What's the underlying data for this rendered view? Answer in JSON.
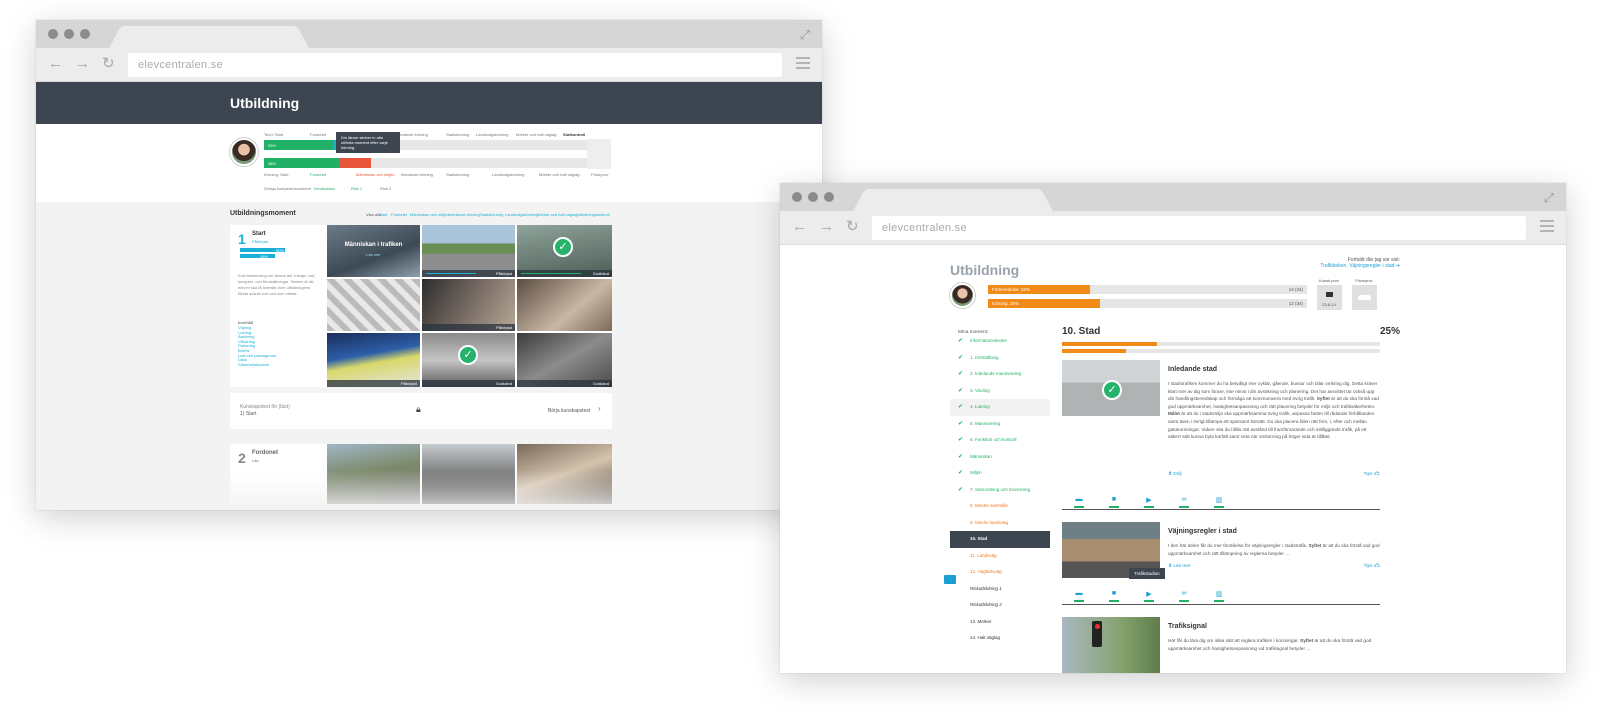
{
  "back_window": {
    "url": "elevcentralen.se",
    "hero_title": "Utbildning",
    "progress_headers": [
      "Start",
      "Fordonet",
      "Människan och miljön",
      "Inledande körning",
      "Stadskörning",
      "Landsvägskörning",
      "Mörker och halt väglag",
      "Slutkontroll"
    ],
    "teori_label": "Teori: Start",
    "korning_label": "Körning: Start",
    "bar1_pct": "33%",
    "bar2_pct": "38%",
    "tooltip": "Din lärare skriver in alla utförda moment efter varje körning.",
    "forprov_label": "Förarprov",
    "legend": [
      "Övriga kompetensmoment",
      "Introduktion",
      "Risk 1",
      "Risk 2"
    ],
    "section_title": "Utbildningsmoment",
    "filter_label": "Visa alla",
    "filters": [
      "Start",
      "Fordonet",
      "Människan och miljön",
      "Inledande körning",
      "Stadskörning",
      "Landsvägskörning",
      "Mörker och halt väglag",
      "Utbildningskontroll"
    ],
    "card1": {
      "number": "1",
      "title": "Start",
      "sub": "Påbörjad",
      "teori_pct": "50%",
      "korning_pct": "28%",
      "desc": "Kort beskrivning om denna del. Inleger vad, kursplan, och förutsättningar. Tanken är att eleven ska få översikt över utbildningens första avsnitt och vad som väntar.",
      "innehall_label": "Innehåll",
      "items": [
        "Väjning",
        "Lutning",
        "Backning",
        "Vändning",
        "Parkering",
        "Broms",
        "Last och passagerare",
        "Däck",
        "Säkerhetskontroll"
      ],
      "tile_title": "Människan i trafiken",
      "tile_sub": "Läs mer",
      "tag_paborjad": "Påbörjad",
      "tag_godkand": "Godkänd"
    },
    "quiz_label": "Kunskapstest för (läst)",
    "quiz_sub": "1) Start",
    "quiz_button": "Börja kunskapstest",
    "card2": {
      "number": "2",
      "title": "Fordonet",
      "sub": "Läs"
    }
  },
  "front_window": {
    "url": "elevcentralen.se",
    "page_title": "Utbildning",
    "continue_label": "Fortsätt där jag var sist:",
    "continue_link": "Trafikboken, Väjningsregler i stad",
    "continue_arrow": "➔",
    "progress": [
      {
        "label": "Förberedelse: 32%",
        "count": "14 (34)",
        "fill": 0.32
      },
      {
        "label": "Körning: 35%",
        "count": "12 (34)",
        "fill": 0.35
      }
    ],
    "kunskapsprov_label": "Kunsk.prov",
    "kunskapsprov_date": "23-8-14",
    "forarprov_label": "Förarprov",
    "sidebar_title": "Mina moment:",
    "sidebar": [
      {
        "label": "Informationstexten",
        "state": "done"
      },
      {
        "label": "1. Körställning",
        "state": "done"
      },
      {
        "label": "2. Inledande manövrering",
        "state": "done"
      },
      {
        "label": "3. Växling",
        "state": "done"
      },
      {
        "label": "4. Lutning",
        "state": "done"
      },
      {
        "label": "5. Manövrering",
        "state": "done"
      },
      {
        "label": "6. Funktion och kontroll",
        "state": "done"
      },
      {
        "label": "Människan",
        "state": "done"
      },
      {
        "label": "Miljön",
        "state": "done"
      },
      {
        "label": "7. Samordning och bromsning",
        "state": "done"
      },
      {
        "label": "8. Mindre samhälle",
        "state": "orange"
      },
      {
        "label": "9. Mindre landsväg",
        "state": "orange"
      },
      {
        "label": "10. Stad",
        "state": "active"
      },
      {
        "label": "11. Landsväg",
        "state": "orange"
      },
      {
        "label": "12. Högfartsväg",
        "state": "orange"
      },
      {
        "label": "Riskutbildning 1",
        "state": "bold"
      },
      {
        "label": "Riskutbildning 2",
        "state": "bold"
      },
      {
        "label": "13. Mörker",
        "state": "plain"
      },
      {
        "label": "14. Halt väglag",
        "state": "plain"
      }
    ],
    "main_title": "10. Stad",
    "main_pct": "25%",
    "lessons": [
      {
        "title": "Inledande stad",
        "text_a": "I stadstrafiken kommer du ha betydligt mer cyklar, gående, bussar och bilar omkring dig. Detta kräver klart mer av dig som förare, inte minst i din avsökning och planering. Det har avsnittet tar också upp din handlingsberedskap och förmåga att kommunicera med övrig trafik.",
        "bold_a": "Syftet",
        "text_b": "är att du ska förstå vad god uppmärksamhet, hastighetsanpassning och rätt placering betyder för miljö och trafiksäkerheten.",
        "bold_b": "Målet",
        "text_c": "är att du i stadsmiljö ska uppmärksamma övrig trafik, anpassa farten till rådande förhållanden samt även i övrigt tillämpa ett sparsamt körsätt. Du ska placera bilen rätt före, i, efter och mellan gatukorsningar. Vidare ska du hålla rätt avstånd till framförvarande och intilliggande trafik, på ett säkert sätt kunna byta körfält samt veta när omkörning på höger sida är tillåtet.",
        "link": "Dölj",
        "tips": "Tips"
      },
      {
        "title": "Väjningsregler i stad",
        "text_a": "I den här delen får du mer förståelse för väjningsregler i stadstrafik.",
        "bold_a": "Syftet",
        "text_b": "är att du ska förstå vad god uppmärksamhet och rätt tillämpning av reglerna betyder ...",
        "link": "Läs mer",
        "tips": "Tips",
        "tooltip": "Trafikstudion"
      },
      {
        "title": "Trafiksignal",
        "text_a": "Här får du lära dig om olika sätt att reglera trafiken i korsningar.",
        "bold_a": "Syftet",
        "text_b": "är att du ska förstå vad god uppmärksamhet och hastighetsanpassning vid trafiksignal betyder ..."
      }
    ],
    "lesson_icons": [
      "book-icon",
      "video-icon",
      "play-icon",
      "link-icon",
      "chart-icon"
    ]
  }
}
